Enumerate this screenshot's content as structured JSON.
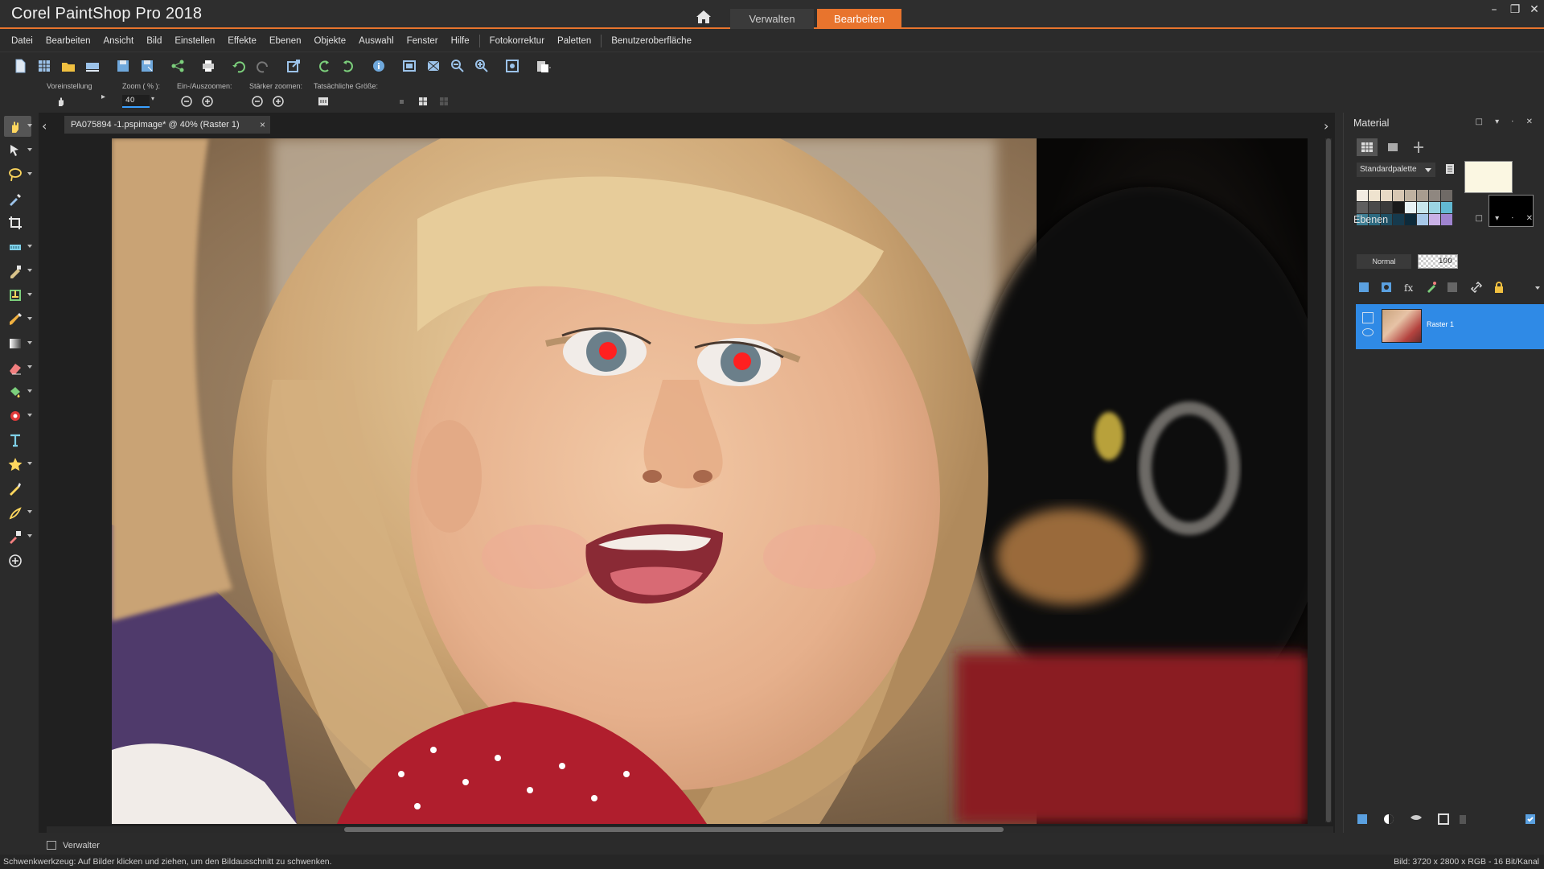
{
  "app": {
    "title": "Corel PaintShop Pro 2018",
    "workspace_tabs": [
      "Verwalten",
      "Bearbeiten"
    ],
    "active_workspace": "Bearbeiten",
    "accent_color": "#e8742d"
  },
  "menu": {
    "items": [
      "Datei",
      "Bearbeiten",
      "Ansicht",
      "Bild",
      "Einstellen",
      "Effekte",
      "Ebenen",
      "Objekte",
      "Auswahl",
      "Fenster",
      "Hilfe",
      "Fotokorrektur",
      "Paletten",
      "Benutzeroberfläche"
    ]
  },
  "tool_options": {
    "preset_label": "Voreinstellung",
    "zoom_label": "Zoom ( % ):",
    "zoom_value": "40",
    "zoom_inout_label": "Ein-/Auszoomen:",
    "zoom_more_label": "Stärker zoomen:",
    "actual_size_label": "Tatsächliche Größe:"
  },
  "document": {
    "tab_label": "PA075894 -1.pspimage* @  40% (Raster 1)",
    "close_glyph": "×"
  },
  "panels": {
    "material": {
      "title": "Material",
      "palette_name": "Standardpalette",
      "foreground_color": "#fbf7e2",
      "background_color": "#000000",
      "swatches": [
        "#f3ece2",
        "#efe3cf",
        "#e8d9c5",
        "#d8c7b3",
        "#bfb1a0",
        "#a89c8f",
        "#8f8780",
        "#6f6a66",
        "#5f5f5f",
        "#4a4a4a",
        "#3a3a3a",
        "#1a1a1a",
        "#e8f2f4",
        "#c8e6ec",
        "#9bd5e3",
        "#62b9d3",
        "#3f7f94",
        "#2d6a80",
        "#1f5064",
        "#163a4d",
        "#0d2a3a",
        "#a7c8e8",
        "#c9b1e6",
        "#9f84d0"
      ]
    },
    "layers": {
      "title": "Ebenen",
      "blend_mode": "Normal",
      "opacity": "100",
      "selected_layer_color": "#2f8ae6",
      "layer_list": [
        {
          "name": "Raster 1"
        }
      ]
    }
  },
  "organizer": {
    "tab_label": "Verwalter"
  },
  "status": {
    "hint": "Schwenkwerkzeug: Auf Bilder klicken und ziehen, um den Bildausschnitt zu schwenken.",
    "image_info": "Bild:  3720 x 2800 x RGB - 16 Bit/Kanal"
  },
  "icons": {
    "toolbar": [
      "new-file-icon",
      "grid-icon",
      "open-folder-icon",
      "scanner-icon",
      "save-icon",
      "save-as-icon",
      "share-icon",
      "print-icon",
      "undo-icon",
      "redo-icon",
      "resize-icon",
      "rotate-left-icon",
      "rotate-right-icon",
      "info-icon",
      "fit-window-icon",
      "fit-image-icon",
      "zoom-out-icon",
      "zoom-in-icon",
      "zoom-actual-icon",
      "paste-icon"
    ],
    "toolbox": [
      "pan-icon",
      "pick-icon",
      "lasso-icon",
      "eyedropper-icon",
      "crop-icon",
      "straighten-icon",
      "clone-brush-icon",
      "makeover-icon",
      "paint-brush-icon",
      "gradient-icon",
      "eraser-icon",
      "fill-icon",
      "red-eye-icon",
      "text-icon",
      "preset-shape-icon",
      "pen-icon",
      "retouch-icon",
      "color-changer-icon",
      "add-tool-icon"
    ]
  }
}
